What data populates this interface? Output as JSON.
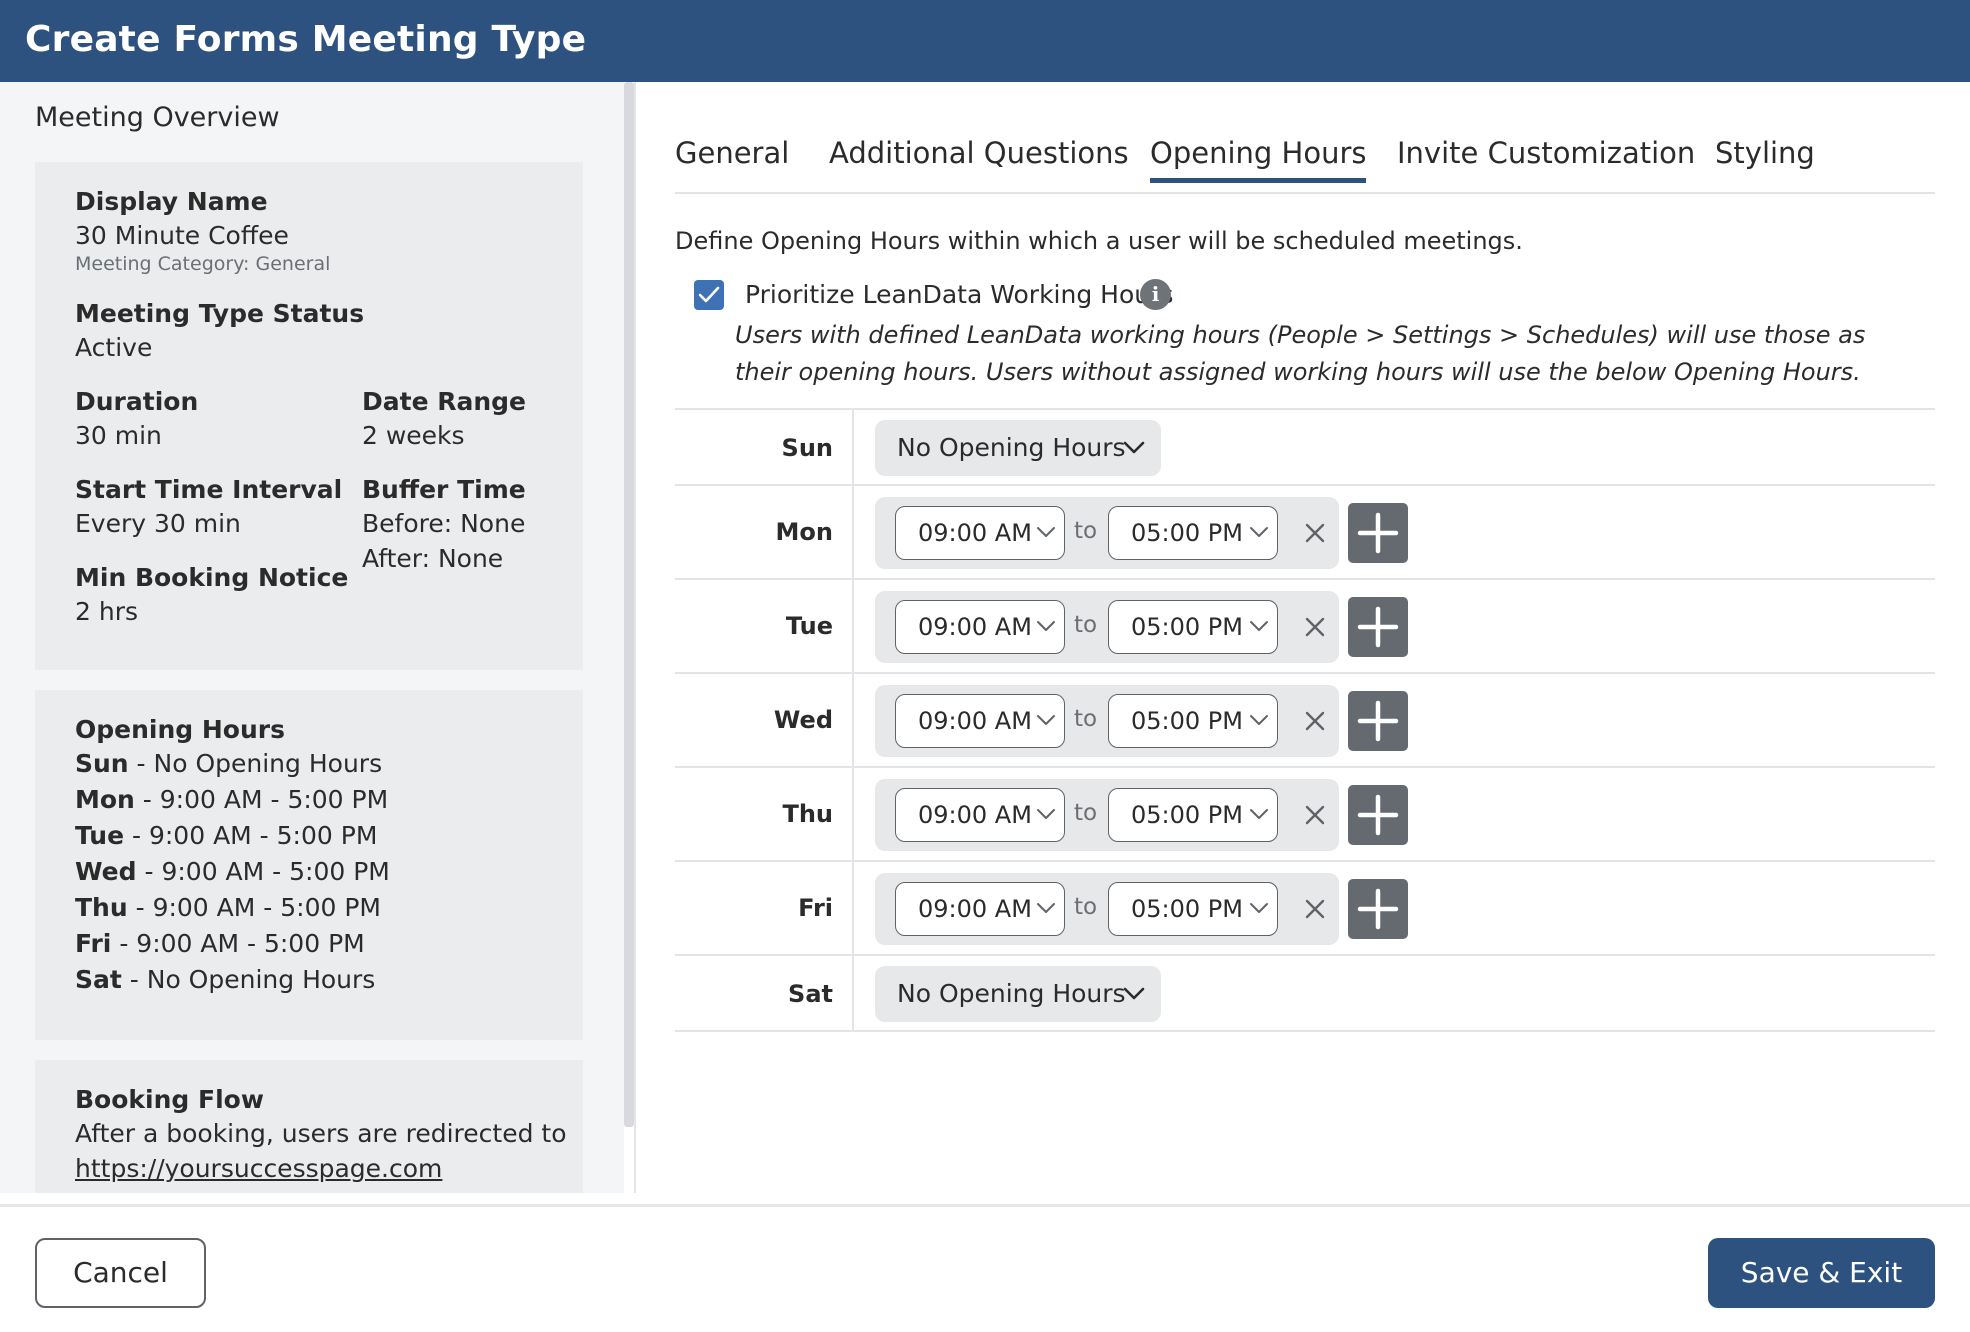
{
  "header": {
    "title": "Create Forms Meeting Type"
  },
  "sidebar": {
    "title": "Meeting Overview",
    "display_name": {
      "label": "Display Name",
      "value": "30 Minute Coffee",
      "category": "Meeting Category: General"
    },
    "status": {
      "label": "Meeting Type Status",
      "value": "Active"
    },
    "duration": {
      "label": "Duration",
      "value": "30 min"
    },
    "date_range": {
      "label": "Date Range",
      "value": "2 weeks"
    },
    "start_interval": {
      "label": "Start Time Interval",
      "value": "Every 30 min"
    },
    "buffer": {
      "label": "Buffer Time",
      "before": "Before: None",
      "after": "After: None"
    },
    "min_notice": {
      "label": "Min Booking Notice",
      "value": "2 hrs"
    },
    "opening_hours": {
      "label": "Opening Hours",
      "lines": [
        {
          "day": "Sun",
          "text": " - No Opening Hours"
        },
        {
          "day": "Mon",
          "text": " - 9:00 AM - 5:00 PM"
        },
        {
          "day": "Tue",
          "text": " - 9:00 AM - 5:00 PM"
        },
        {
          "day": "Wed",
          "text": " - 9:00 AM - 5:00 PM"
        },
        {
          "day": "Thu",
          "text": " - 9:00 AM - 5:00 PM"
        },
        {
          "day": "Fri",
          "text": " - 9:00 AM - 5:00 PM"
        },
        {
          "day": "Sat",
          "text": " - No Opening Hours"
        }
      ]
    },
    "booking_flow": {
      "label": "Booking Flow",
      "text": "After a booking, users are redirected to",
      "link": "https://yoursuccesspage.com"
    }
  },
  "tabs": [
    {
      "label": "General"
    },
    {
      "label": "Additional Questions"
    },
    {
      "label": "Opening Hours",
      "active": true
    },
    {
      "label": "Invite Customization"
    },
    {
      "label": "Styling"
    }
  ],
  "main": {
    "description": "Define Opening Hours within which a user will be scheduled meetings.",
    "prioritize": {
      "label": "Prioritize LeanData Working Hours",
      "checked": true,
      "note": "Users with defined LeanData working hours (People > Settings > Schedules) will use those as their opening hours. Users without assigned working hours will use the below Opening Hours."
    },
    "to_label": "to",
    "days": [
      {
        "day": "Sun",
        "mode": "No Opening Hours"
      },
      {
        "day": "Mon",
        "from": "09:00 AM",
        "to": "05:00 PM"
      },
      {
        "day": "Tue",
        "from": "09:00 AM",
        "to": "05:00 PM"
      },
      {
        "day": "Wed",
        "from": "09:00 AM",
        "to": "05:00 PM"
      },
      {
        "day": "Thu",
        "from": "09:00 AM",
        "to": "05:00 PM"
      },
      {
        "day": "Fri",
        "from": "09:00 AM",
        "to": "05:00 PM"
      },
      {
        "day": "Sat",
        "mode": "No Opening Hours"
      }
    ]
  },
  "footer": {
    "cancel": "Cancel",
    "save": "Save & Exit"
  },
  "colors": {
    "header": "#2d5280",
    "accent": "#3e72b5",
    "add_button": "#656a70"
  }
}
